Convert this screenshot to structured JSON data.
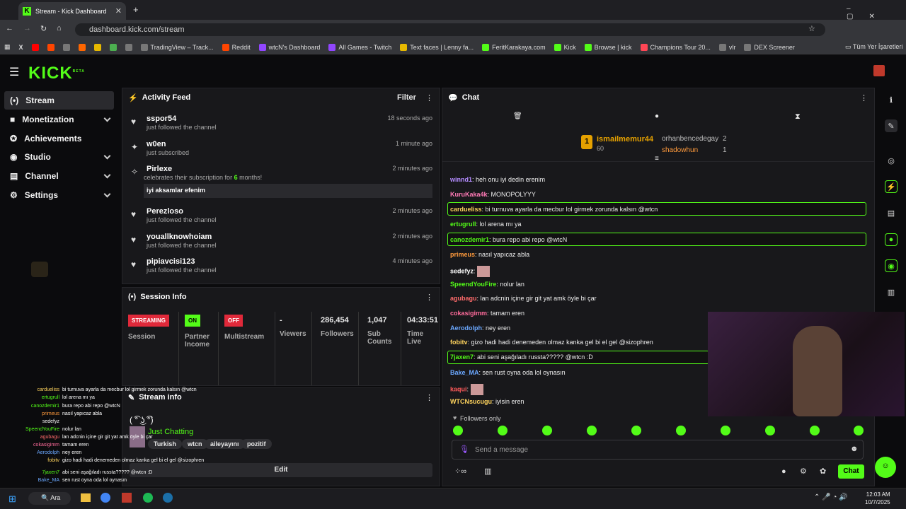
{
  "browser": {
    "tab_title": "Stream - Kick Dashboard",
    "url": "dashboard.kick.com/stream",
    "bookmarks": [
      "TradingView – Track...",
      "Reddit",
      "wtcN's Dashboard",
      "All Games - Twitch",
      "Text faces | Lenny fa...",
      "FeritKarakaya.com",
      "Kick",
      "Browse | kick",
      "Champions Tour 20...",
      "vlr",
      "DEX Screener"
    ],
    "all_bookmarks": "Tüm Yer İşaretleri"
  },
  "logo": "KICK",
  "logo_beta": "BETA",
  "sidebar": {
    "items": [
      {
        "label": "Stream"
      },
      {
        "label": "Monetization"
      },
      {
        "label": "Achievements"
      },
      {
        "label": "Studio"
      },
      {
        "label": "Channel"
      },
      {
        "label": "Settings"
      }
    ]
  },
  "activity": {
    "title": "Activity Feed",
    "filter": "Filter",
    "items": [
      {
        "name": "sspor54",
        "sub": "just followed the channel",
        "time": "18 seconds ago"
      },
      {
        "name": "w0en",
        "sub": "just subscribed",
        "time": "1 minute ago"
      },
      {
        "name": "Pirlexe",
        "sub": "celebrates their subscription for",
        "months": "6",
        "sub_tail": "months!",
        "time": "2 minutes ago",
        "message": "iyi aksamlar efenim"
      },
      {
        "name": "Perezloso",
        "sub": "just followed the channel",
        "time": "2 minutes ago"
      },
      {
        "name": "youallknowhoiam",
        "sub": "just followed the channel",
        "time": "2 minutes ago"
      },
      {
        "name": "pipiavcisi123",
        "sub": "just followed the channel",
        "time": "4 minutes ago"
      }
    ]
  },
  "session": {
    "title": "Session Info",
    "streaming": "STREAMING",
    "session_label": "Session",
    "partner_badge": "ON",
    "partner_label": "Partner Income",
    "multi_badge": "OFF",
    "multi_label": "Multistream",
    "viewers": "-",
    "viewers_label": "Viewers",
    "followers": "286,454",
    "followers_label": "Followers",
    "subs": "1,047",
    "subs_label": "Sub Counts",
    "time": "04:33:51",
    "time_label": "Time Live"
  },
  "streaminfo": {
    "title": "Stream info",
    "lenny": "( ͡° ͜ʖ ͡°)",
    "category": "Just Chatting",
    "tags": [
      "Turkish",
      "wtcn",
      "aileyayını",
      "pozitif"
    ],
    "edit": "Edit"
  },
  "chat": {
    "title": "Chat",
    "leaders": {
      "first": {
        "rank": "1",
        "name": "ismailmemur44",
        "points": "60"
      },
      "second": {
        "name": "orhanbencedegay",
        "points": "2"
      },
      "third": {
        "name": "shadowhun",
        "points": "1"
      }
    },
    "messages": [
      {
        "user": "winnd1",
        "text": "heh onu iyi dedin erenim",
        "color": "#b48cff"
      },
      {
        "user": "KuruKaka4k",
        "text": "MONOPOLYYY",
        "color": "#ff7ab6"
      },
      {
        "user": "cardueliss",
        "text": "bi turnuva ayarla da mecbur lol girmek zorunda kalsın @wtcn",
        "color": "#ffd45e"
      },
      {
        "user": "ertugrull",
        "text": "lol arena mı ya",
        "color": "#53fc18"
      },
      {
        "user": "canozdemir1",
        "text": "bura repo abi repo @wtcN",
        "color": "#53fc18"
      },
      {
        "user": "primeus",
        "text": "nasıl yapıcaz abla",
        "color": "#ff9a3c"
      },
      {
        "user": "sedefyz",
        "text": "",
        "color": "#ffffff"
      },
      {
        "user": "SpeendYouFire",
        "text": "nolur lan",
        "color": "#53fc18"
      },
      {
        "user": "agubagu",
        "text": "lan adcnin içine gir git yat amk öyle bi çar",
        "color": "#ff6b6b"
      },
      {
        "user": "cokasigimm",
        "text": "tamam eren",
        "color": "#ff6b9b"
      },
      {
        "user": "Aerodolph",
        "text": "ney eren",
        "color": "#6ba8ff"
      },
      {
        "user": "fobitv",
        "text": "gizo hadi hadi denemeden olmaz kanka gel bi el gel @sizophren",
        "color": "#ffd45e"
      },
      {
        "user": "7jaxen7",
        "text": "abi seni aşağıladı russta????? @wtcn :D",
        "color": "#53fc18"
      },
      {
        "user": "Bake_MA",
        "text": "sen rust oyna oda lol oynasın",
        "color": "#6ba8ff"
      },
      {
        "user": "kaqui",
        "text": "",
        "color": "#ff5a5a"
      },
      {
        "user": "WTCNsucugu",
        "text": "iyisin eren",
        "color": "#ffd45e"
      }
    ],
    "followers_only": "Followers only",
    "placeholder": "Send a message",
    "send": "Chat"
  },
  "taskbar": {
    "search": "Ara",
    "time": "12:03 AM",
    "date": "10/7/2025"
  }
}
